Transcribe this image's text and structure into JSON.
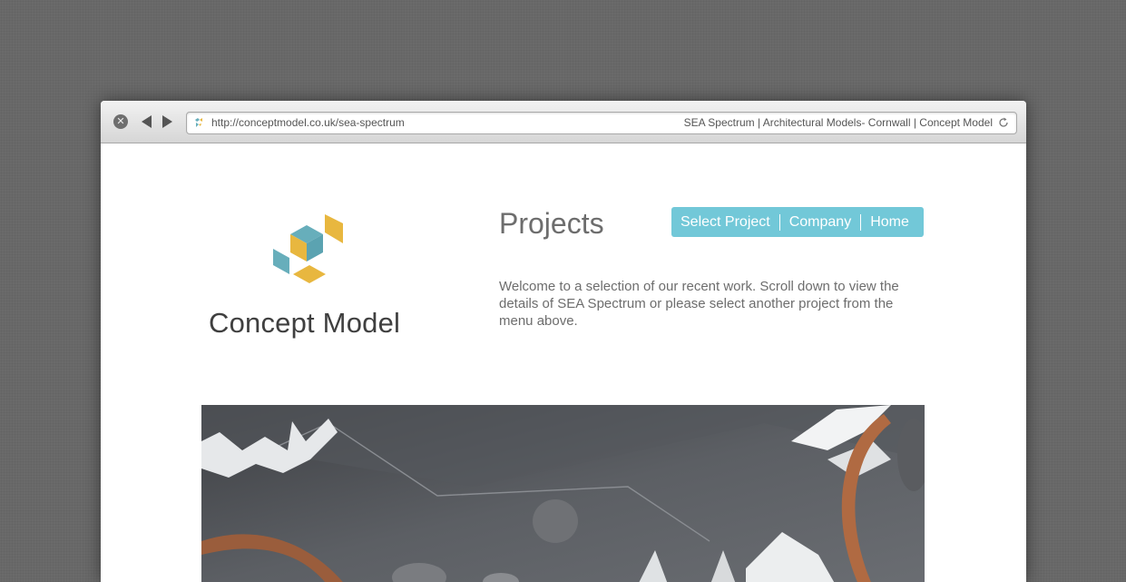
{
  "browser": {
    "url": "http://conceptmodel.co.uk/sea-spectrum",
    "page_title": "SEA Spectrum | Architectural Models- Cornwall | Concept Model",
    "icons": {
      "close": "close-icon",
      "back": "back-arrow-icon",
      "forward": "forward-arrow-icon",
      "favicon": "site-favicon-icon",
      "reload": "reload-icon"
    }
  },
  "site": {
    "brand_name": "Concept Model",
    "logo_colors": {
      "teal": "#67aebb",
      "yellow": "#e8b73f"
    },
    "heading": "Projects",
    "intro": "Welcome to a selection of our recent work. Scroll down to view the details of SEA Spectrum or please select another project from the menu above.",
    "nav": {
      "background": "#72c8d8",
      "items": [
        {
          "label": "Select Project"
        },
        {
          "label": "Company"
        },
        {
          "label": "Home"
        }
      ]
    }
  }
}
